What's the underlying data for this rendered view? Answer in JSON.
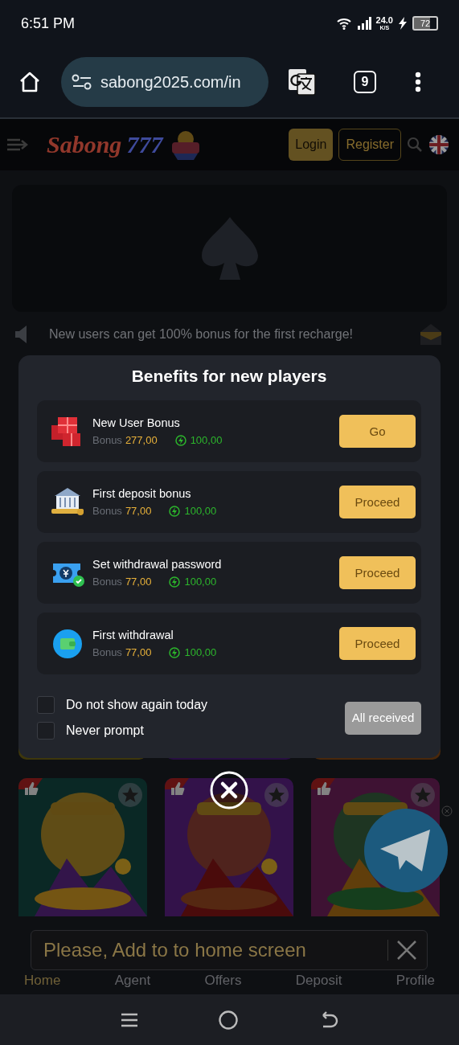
{
  "status_bar": {
    "time": "6:51 PM",
    "speed": "24.0",
    "speed_unit": "K/S",
    "battery": "72"
  },
  "browser": {
    "url": "sabong2025.com/in",
    "tab_count": "9"
  },
  "site_header": {
    "logo_word": "Sabong",
    "logo_number": "777",
    "login": "Login",
    "register": "Register"
  },
  "notice": {
    "text": "New users can get 100% bonus for the first recharge!"
  },
  "modal": {
    "title": "Benefits for new players",
    "items": [
      {
        "kind": "gift",
        "title": "New User Bonus",
        "bonus_label": "Bonus",
        "bonus": "277,00",
        "reward": "100,00",
        "button": "Go"
      },
      {
        "kind": "bank",
        "title": "First deposit bonus",
        "bonus_label": "Bonus",
        "bonus": "77,00",
        "reward": "100,00",
        "button": "Proceed"
      },
      {
        "kind": "ticket",
        "title": "Set withdrawal password",
        "bonus_label": "Bonus",
        "bonus": "77,00",
        "reward": "100,00",
        "button": "Proceed"
      },
      {
        "kind": "wallet",
        "title": "First withdrawal",
        "bonus_label": "Bonus",
        "bonus": "77,00",
        "reward": "100,00",
        "button": "Proceed"
      }
    ],
    "options": [
      {
        "label": "Do not show again today",
        "checked": false
      },
      {
        "label": "Never prompt",
        "checked": false
      }
    ],
    "all_received": {
      "label": "All received",
      "disabled": true
    }
  },
  "install_banner": {
    "text": "Please, Add to to home screen"
  },
  "bottom_nav": [
    "Home",
    "Agent",
    "Offers",
    "Deposit",
    "Profile"
  ]
}
